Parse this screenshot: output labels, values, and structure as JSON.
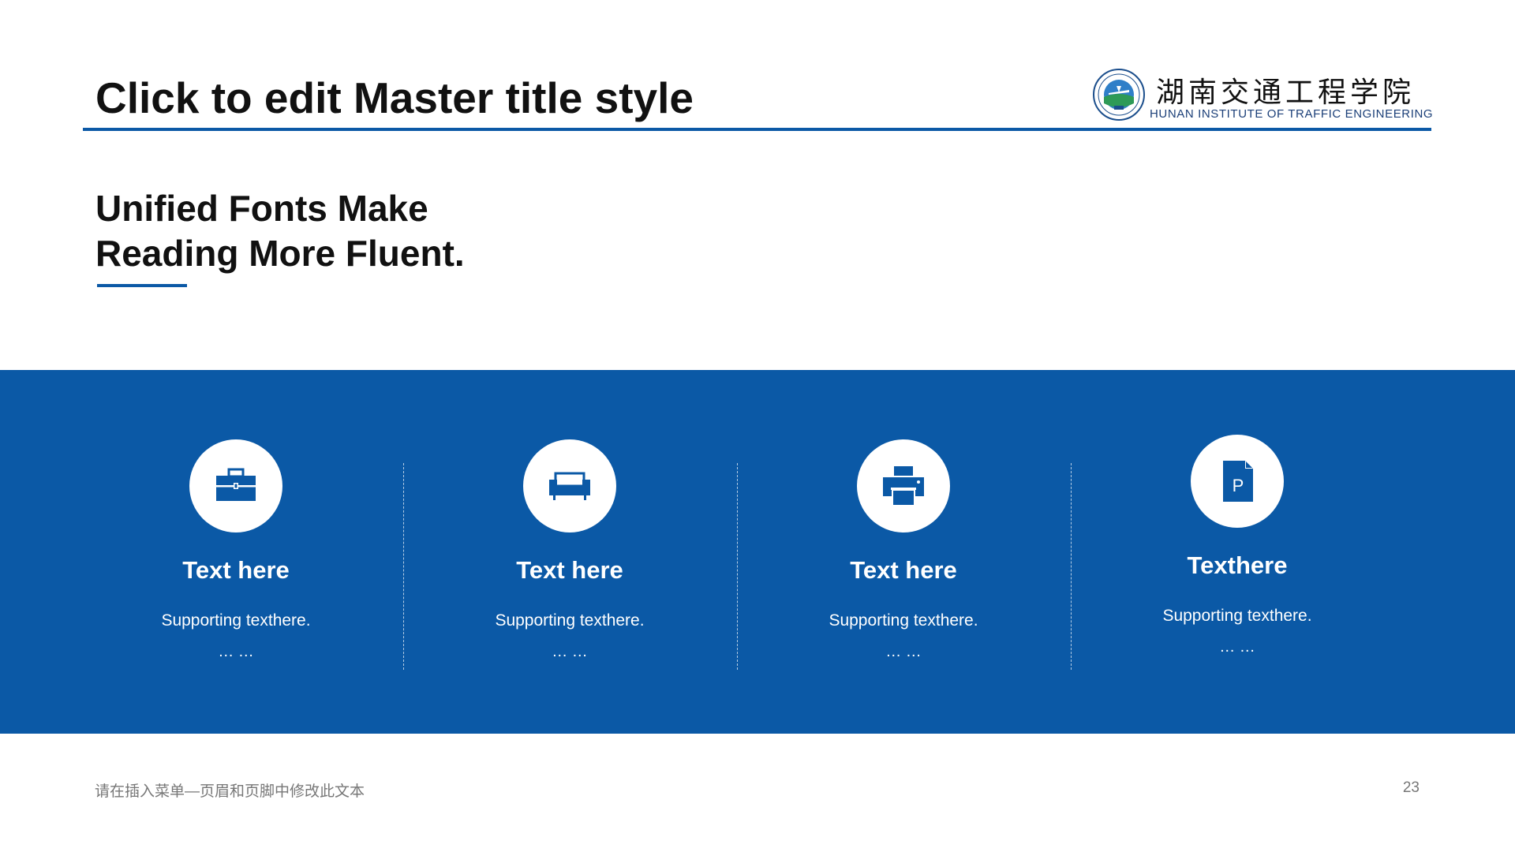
{
  "slide": {
    "title": "Click to edit Master title style",
    "subtitle_line1": "Unified Fonts Make",
    "subtitle_line2": "Reading More Fluent.",
    "logo": {
      "name_cn": "湖南交通工程学院",
      "name_en": "HUNAN INSTITUTE OF TRAFFIC ENGINEERING"
    },
    "colors": {
      "accent": "#0b59a6",
      "title_text": "#111111",
      "footer_text": "#777777"
    },
    "items": [
      {
        "icon": "briefcase-icon",
        "title": "Text here",
        "text": "Supporting texthere.",
        "dots": "… …"
      },
      {
        "icon": "sofa-icon",
        "title": "Text here",
        "text": "Supporting texthere.",
        "dots": "… …"
      },
      {
        "icon": "printer-icon",
        "title": "Text here",
        "text": "Supporting texthere.",
        "dots": "… …"
      },
      {
        "icon": "document-p-icon",
        "title": "Texthere",
        "text": "Supporting texthere.",
        "dots": "… …"
      }
    ],
    "footer": "请在插入菜单—页眉和页脚中修改此文本",
    "page_number": "23"
  }
}
